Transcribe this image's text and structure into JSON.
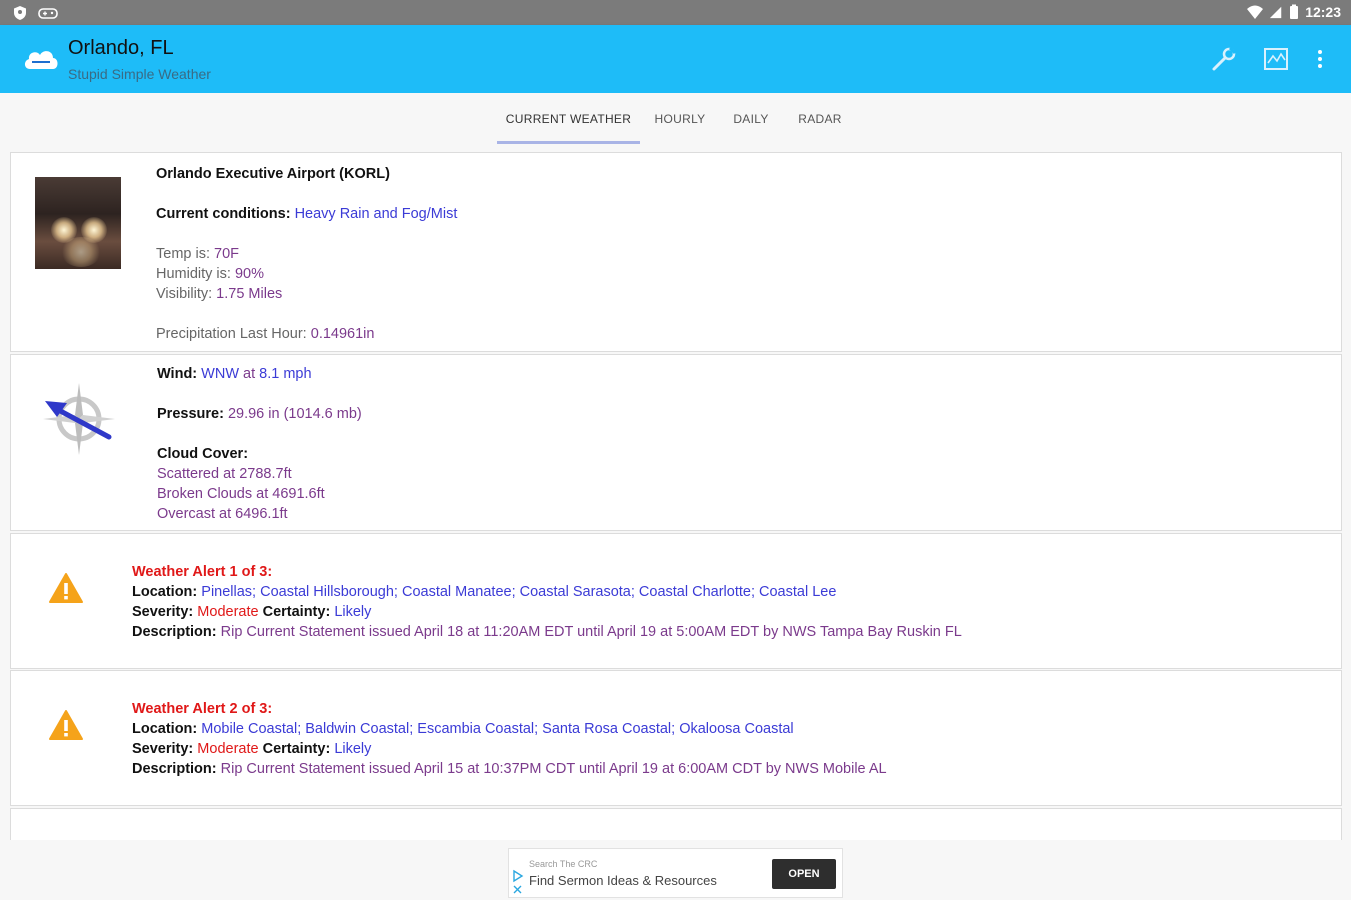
{
  "status_bar": {
    "time": "12:23"
  },
  "app_bar": {
    "title": "Orlando, FL",
    "subtitle": "Stupid Simple Weather",
    "logo_icon": "cloud-logo-icon",
    "actions": [
      "wrench-icon",
      "map-icon",
      "more-vert-icon"
    ],
    "color": "#1ebcf8"
  },
  "tabs": [
    {
      "label": "CURRENT WEATHER",
      "active": true
    },
    {
      "label": "HOURLY",
      "active": false
    },
    {
      "label": "DAILY",
      "active": false
    },
    {
      "label": "RADAR",
      "active": false
    }
  ],
  "observation": {
    "station": "Orlando Executive Airport (KORL)",
    "conditions_label": "Current conditions:",
    "conditions_value": "Heavy Rain and Fog/Mist",
    "temp_label": "Temp is:",
    "temp_value": "70F",
    "humidity_label": "Humidity is:",
    "humidity_value": "90%",
    "visibility_label": "Visibility:",
    "visibility_value": "1.75 Miles",
    "precip_label": "Precipitation Last Hour:",
    "precip_value": "0.14961in"
  },
  "wind": {
    "wind_label": "Wind:",
    "wind_dir": "WNW",
    "wind_at": "at",
    "wind_speed": "8.1 mph",
    "pressure_label": "Pressure:",
    "pressure_value": "29.96 in (1014.6 mb)",
    "cloud_label": "Cloud Cover:",
    "clouds": [
      "Scattered at 2788.7ft",
      "Broken Clouds at 4691.6ft",
      "Overcast at 6496.1ft"
    ]
  },
  "alerts": [
    {
      "title": "Weather Alert 1 of 3:",
      "location_label": "Location:",
      "location": "Pinellas; Coastal Hillsborough; Coastal Manatee; Coastal Sarasota; Coastal Charlotte; Coastal Lee",
      "severity_label": "Severity:",
      "severity": "Moderate",
      "certainty_label": "Certainty:",
      "certainty": "Likely",
      "description_label": "Description:",
      "description": "Rip Current Statement issued April 18 at 11:20AM EDT until April 19 at 5:00AM EDT by NWS Tampa Bay Ruskin FL"
    },
    {
      "title": "Weather Alert 2 of 3:",
      "location_label": "Location:",
      "location": "Mobile Coastal; Baldwin Coastal; Escambia Coastal; Santa Rosa Coastal; Okaloosa Coastal",
      "severity_label": "Severity:",
      "severity": "Moderate",
      "certainty_label": "Certainty:",
      "certainty": "Likely",
      "description_label": "Description:",
      "description": "Rip Current Statement issued April 15 at 10:37PM CDT until April 19 at 6:00AM CDT by NWS Mobile AL"
    }
  ],
  "ad": {
    "sub": "Search The CRC",
    "main": "Find Sermon Ideas & Resources",
    "button": "OPEN"
  }
}
